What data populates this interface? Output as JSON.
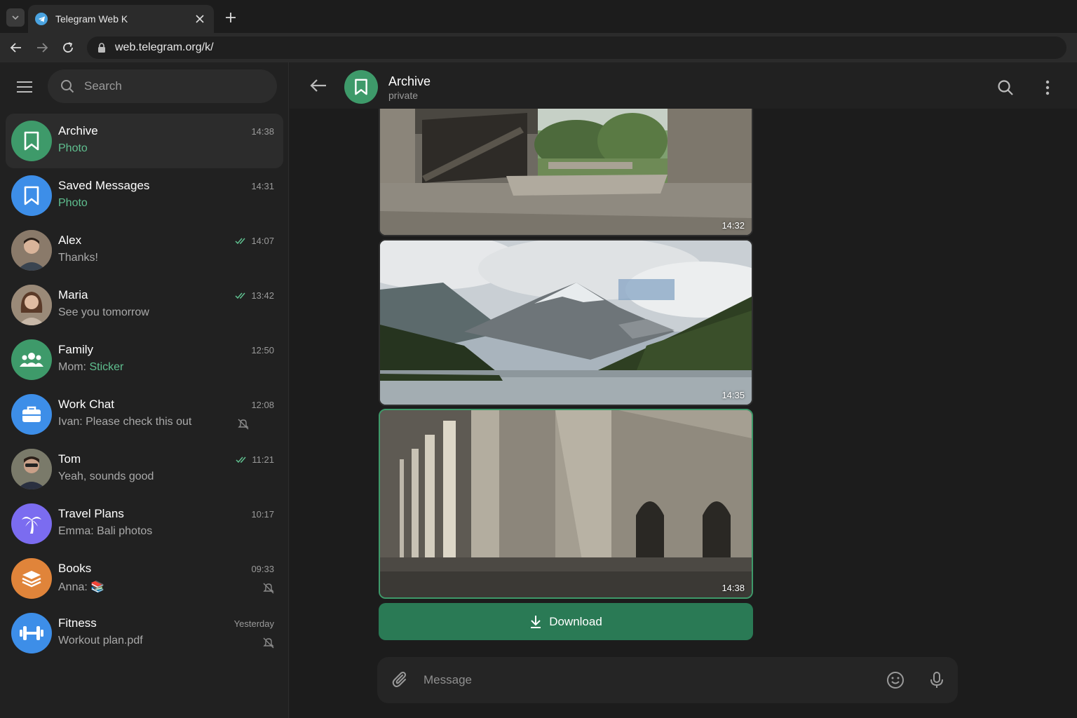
{
  "browser": {
    "tab_title": "Telegram Web K",
    "url": "web.telegram.org/k/"
  },
  "sidebar": {
    "search_placeholder": "Search",
    "chats": [
      {
        "name": "Archive",
        "preview": "Photo",
        "preview_accent": true,
        "time": "14:38",
        "avatar_color": "#3e9a6a",
        "avatar_icon": "bookmark-icon",
        "active": true
      },
      {
        "name": "Saved Messages",
        "preview": "Photo",
        "preview_accent": true,
        "time": "14:31",
        "avatar_color": "#3d8ee8",
        "avatar_icon": "bookmark-icon"
      },
      {
        "name": "Alex",
        "preview": "Thanks!",
        "time": "14:07",
        "read": true,
        "avatar_icon": "person-photo"
      },
      {
        "name": "Maria",
        "preview": "See you tomorrow",
        "time": "13:42",
        "read": true,
        "avatar_icon": "person-photo"
      },
      {
        "name": "Family",
        "preview_prefix": "Mom: ",
        "preview": "Sticker",
        "preview_accent": true,
        "time": "12:50",
        "avatar_color": "#3e9a6a",
        "avatar_icon": "group-icon"
      },
      {
        "name": "Work Chat",
        "preview": "Ivan: Please check this out",
        "time": "12:08",
        "muted": true,
        "avatar_color": "#3d8ee8",
        "avatar_icon": "briefcase-icon"
      },
      {
        "name": "Tom",
        "preview": "Yeah, sounds good",
        "time": "11:21",
        "read": true,
        "avatar_icon": "person-photo"
      },
      {
        "name": "Travel Plans",
        "preview": "Emma: Bali photos",
        "time": "10:17",
        "avatar_color": "#7b6cf0",
        "avatar_icon": "palm-tree-icon"
      },
      {
        "name": "Books",
        "preview": "Anna: 📚",
        "time": "09:33",
        "muted": true,
        "avatar_color": "#e0843a",
        "avatar_icon": "books-icon"
      },
      {
        "name": "Fitness",
        "preview": "Workout plan.pdf",
        "time": "Yesterday",
        "muted": true,
        "avatar_color": "#3d8ee8",
        "avatar_icon": "dumbbell-icon"
      }
    ]
  },
  "chat": {
    "title": "Archive",
    "subtitle": "private",
    "photos": [
      {
        "time": "14:32",
        "subject": "concrete interior with large window"
      },
      {
        "time": "14:35",
        "subject": "mountain lake landscape"
      },
      {
        "time": "14:38",
        "subject": "concrete corridor with arches",
        "selected": true
      }
    ],
    "download_label": "Download",
    "message_placeholder": "Message"
  },
  "colors": {
    "accent_green": "#3e9a6a",
    "download_bg": "#2a7a55",
    "accent_text": "#5fbf8f"
  }
}
